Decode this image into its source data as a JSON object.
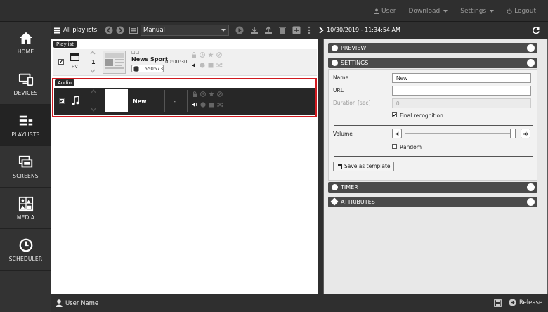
{
  "topnav": {
    "user_label": "User",
    "download_label": "Download",
    "settings_label": "Settings",
    "logout_label": "Logout"
  },
  "sidebar": {
    "items": [
      {
        "label": "HOME"
      },
      {
        "label": "DEVICES"
      },
      {
        "label": "PLAYLISTS"
      },
      {
        "label": "SCREENS"
      },
      {
        "label": "MEDIA"
      },
      {
        "label": "SCHEDULER"
      }
    ],
    "active_index": 2
  },
  "playlist_panel": {
    "title": "All playlists",
    "mode": "Manual",
    "rows": [
      {
        "tag": "Playlist",
        "order": "1",
        "orientation": "HV",
        "small_label": "□□",
        "name": "News Sport",
        "duration": "00:00:30",
        "id_value": "15505733"
      },
      {
        "tag": "Audio",
        "name": "New",
        "duration": "-"
      }
    ]
  },
  "details_panel": {
    "timestamp": "10/30/2019 - 11:34:54 AM",
    "sections": {
      "preview": "PREVIEW",
      "settings": "SETTINGS",
      "timer": "TIMER",
      "attributes": "ATTRIBUTES"
    },
    "settings": {
      "name_label": "Name",
      "name_value": "New",
      "url_label": "URL",
      "url_value": "",
      "duration_label": "Duration [sec]",
      "duration_value": "0",
      "final_recognition_label": "Final recognition",
      "final_recognition_checked": true,
      "volume_label": "Volume",
      "volume_level": 1.0,
      "random_label": "Random",
      "random_checked": false,
      "save_template_label": "Save as template"
    }
  },
  "bottombar": {
    "user_name": "User Name",
    "release_label": "Release"
  }
}
